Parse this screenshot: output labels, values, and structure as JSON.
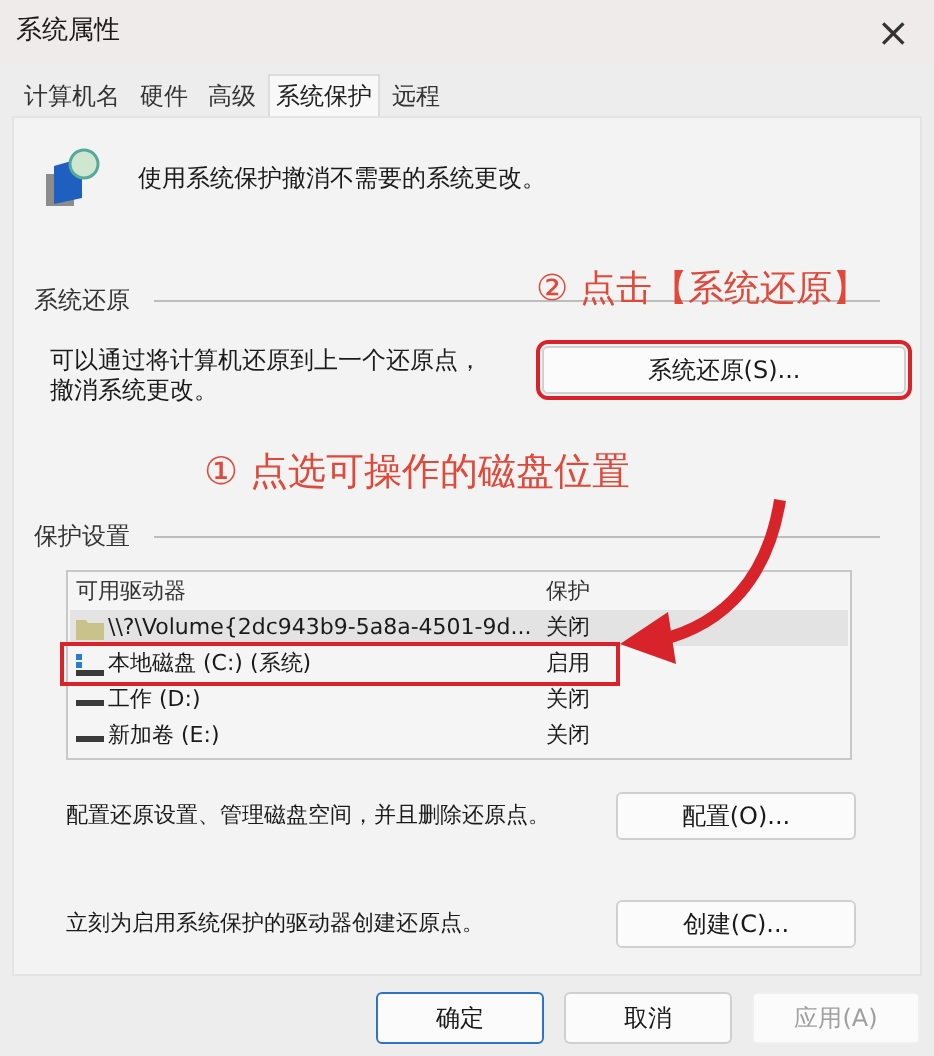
{
  "window": {
    "title": "系统属性",
    "close": "×"
  },
  "tabs": [
    {
      "label": "计算机名",
      "selected": false
    },
    {
      "label": "硬件",
      "selected": false
    },
    {
      "label": "高级",
      "selected": false
    },
    {
      "label": "系统保护",
      "selected": true
    },
    {
      "label": "远程",
      "selected": false
    }
  ],
  "intro": "使用系统保护撤消不需要的系统更改。",
  "restore_group": {
    "title": "系统还原",
    "description": "可以通过将计算机还原到上一个还原点，撤消系统更改。",
    "button": {
      "label": "系统还原(S)...",
      "annotated": true
    }
  },
  "annotations": [
    {
      "text": "② 点击【系统还原】"
    },
    {
      "text": "① 点选可操作的磁盘位置"
    }
  ],
  "protection_group": {
    "title": "保护设置",
    "columns": [
      "可用驱动器",
      "保护"
    ],
    "rows": [
      {
        "kind": "volume",
        "drive": "\\\\?\\Volume{2dc943b9-5a8a-4501-9d...",
        "protection": "关闭",
        "selected": true,
        "annotated": false
      },
      {
        "kind": "system",
        "drive": "本地磁盘 (C:) (系统)",
        "protection": "启用",
        "selected": false,
        "annotated": true
      },
      {
        "kind": "disk",
        "drive": "工作 (D:)",
        "protection": "关闭",
        "selected": false,
        "annotated": false
      },
      {
        "kind": "disk",
        "drive": "新加卷 (E:)",
        "protection": "关闭",
        "selected": false,
        "annotated": false
      }
    ],
    "configure_text": "配置还原设置、管理磁盘空间，并且删除还原点。",
    "configure_button": "配置(O)...",
    "create_text": "立刻为启用系统保护的驱动器创建还原点。",
    "create_button": "创建(C)..."
  },
  "buttons": [
    {
      "label": "确定",
      "kind": "default",
      "disabled": false
    },
    {
      "label": "取消",
      "kind": "normal",
      "disabled": false
    },
    {
      "label": "应用(A)",
      "kind": "normal",
      "disabled": true
    }
  ]
}
